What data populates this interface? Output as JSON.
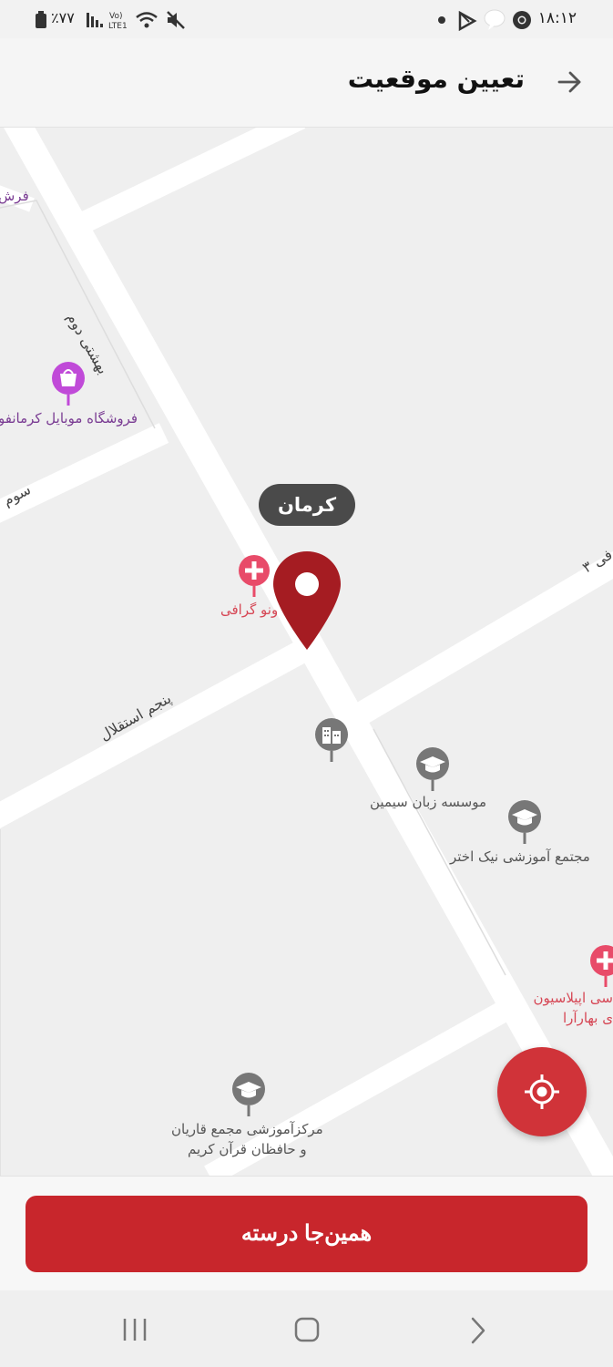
{
  "status_bar": {
    "time": "۱۸:۱۲",
    "battery_text": "٪۷۷",
    "network_label": "Vo) LTE1",
    "icons": [
      "battery-icon",
      "signal-icon",
      "volte-icon",
      "wifi-icon",
      "mute-icon",
      "dot-icon",
      "play-store-icon",
      "message-icon",
      "chrome-icon"
    ]
  },
  "header": {
    "title": "تعیین موقعیت",
    "back_icon": "arrow-right-icon"
  },
  "map": {
    "city_chip": "کرمان",
    "pois": [
      {
        "label": "فروشگاه موبایل کرمانفو",
        "icon": "shopping-bag-icon",
        "color": "#c04ad8"
      },
      {
        "label": "ونو گرافی",
        "icon": "plus-icon",
        "color": "#e84b69"
      },
      {
        "label": "موسسه زبان سیمین",
        "icon": "graduation-cap-icon",
        "color": "#777777"
      },
      {
        "label": "مجتمع آموزشی نیک اختر",
        "icon": "graduation-cap-icon",
        "color": "#777777"
      },
      {
        "label_line1": "سی اپیلاسیون",
        "label_line2": "ی بهارآرا",
        "icon": "plus-icon",
        "color": "#e84b69"
      },
      {
        "label_line1": "مرکزآموزشی مجمع قاریان",
        "label_line2": "و حافظان قرآن کریم",
        "icon": "graduation-cap-icon",
        "color": "#777777"
      },
      {
        "label": "",
        "icon": "building-icon",
        "color": "#777777"
      }
    ],
    "streets": {
      "behesht_dovom": "بهشتی دوم",
      "panjom_esteghlal": "پنجم استقلال",
      "sevom": "سوم",
      "fe_3": "فی ۳",
      "farsh": "فرش"
    },
    "pin_color": "#a51c22",
    "locate_button_icon": "crosshair-icon"
  },
  "bottom": {
    "confirm_label": "همین‌جا درسته",
    "accent": "#c8262c"
  },
  "nav_bar": {
    "icons": [
      "recent-apps-icon",
      "home-icon",
      "back-chevron-icon"
    ]
  }
}
